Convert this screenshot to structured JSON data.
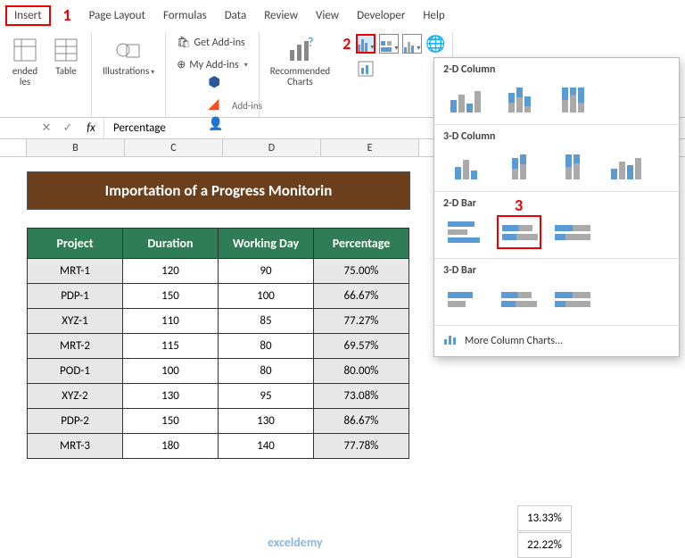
{
  "tabs": {
    "insert": "Insert",
    "page_layout": "Page Layout",
    "formulas": "Formulas",
    "data": "Data",
    "review": "Review",
    "view": "View",
    "developer": "Developer",
    "help": "Help"
  },
  "annotations": {
    "one": "1",
    "two": "2",
    "three": "3"
  },
  "ribbon": {
    "ended": "ended",
    "les": "les",
    "table": "Table",
    "illustrations": "Illustrations",
    "get_addins": "Get Add-ins",
    "my_addins": "My Add-ins",
    "addins_group": "Add-ins",
    "rec_charts": "Recommended\nCharts"
  },
  "formula_bar": {
    "cancel": "✕",
    "enter": "✓",
    "fx": "fx",
    "value": "Percentage"
  },
  "cols": [
    "B",
    "C",
    "D",
    "E"
  ],
  "title": "Importation of a Progress Monitorin",
  "headers": {
    "project": "Project",
    "duration": "Duration",
    "working": "Working Day",
    "percentage": "Percentage"
  },
  "rows": [
    {
      "p": "MRT-1",
      "d": "120",
      "w": "90",
      "pc": "75.00%",
      "extra": ""
    },
    {
      "p": "PDP-1",
      "d": "150",
      "w": "100",
      "pc": "66.67%",
      "extra": ""
    },
    {
      "p": "XYZ-1",
      "d": "110",
      "w": "85",
      "pc": "77.27%",
      "extra": ""
    },
    {
      "p": "MRT-2",
      "d": "115",
      "w": "80",
      "pc": "69.57%",
      "extra": ""
    },
    {
      "p": "POD-1",
      "d": "100",
      "w": "80",
      "pc": "80.00%",
      "extra": ""
    },
    {
      "p": "XYZ-2",
      "d": "130",
      "w": "95",
      "pc": "73.08%",
      "extra": ""
    },
    {
      "p": "PDP-2",
      "d": "150",
      "w": "130",
      "pc": "86.67%",
      "extra": "13.33%"
    },
    {
      "p": "MRT-3",
      "d": "180",
      "w": "140",
      "pc": "77.78%",
      "extra": "22.22%"
    }
  ],
  "dropdown": {
    "sec1": "2-D Column",
    "sec2": "3-D Column",
    "sec3": "2-D Bar",
    "sec4": "3-D Bar",
    "more": "More Column Charts..."
  },
  "watermark": "exceldemy"
}
